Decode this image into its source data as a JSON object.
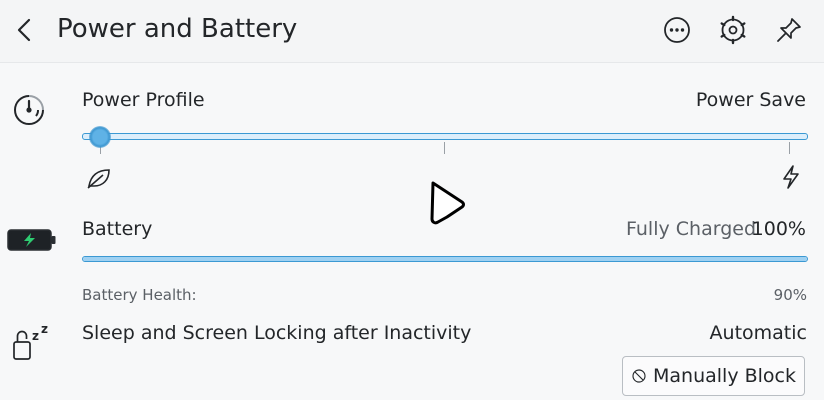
{
  "header": {
    "title": "Power and Battery",
    "back_icon": "chevron-left-icon",
    "actions": [
      "more-options-icon",
      "configure-icon",
      "pin-icon"
    ]
  },
  "power_profile": {
    "label": "Power Profile",
    "value": "Power Save",
    "level_fraction": 0.0,
    "left_icon": "leaf-icon",
    "right_icon": "lightning-icon"
  },
  "battery": {
    "label": "Battery",
    "status": "Fully Charged",
    "percent": "100%",
    "charge_fraction": 1.0,
    "health_label": "Battery Health:",
    "health_value": "90%",
    "icon": "battery-charging-icon"
  },
  "sleep": {
    "label": "Sleep and Screen Locking after Inactivity",
    "value": "Automatic",
    "button_label": "Manually Block",
    "icon": "lock-sleep-icon",
    "button_icon": "block-icon"
  },
  "colors": {
    "accent": "#3b99d3",
    "battery_green": "#2ecc71",
    "text": "#232629"
  }
}
